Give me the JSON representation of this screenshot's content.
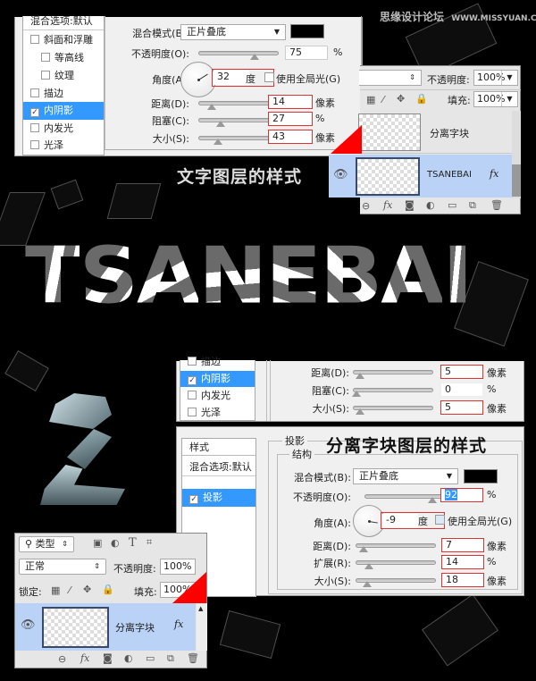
{
  "watermark": {
    "site_name": "思缘设计论坛",
    "site_url": "WWW.MISSYUAN.COM"
  },
  "captions": {
    "text_layer_style": "文字图层的样式",
    "split_block_layer_style": "分离字块图层的样式"
  },
  "artwork": {
    "title_text": "TSANEBAI",
    "colors": {
      "light": "#ffffff",
      "dark": "#6a6a6a"
    }
  },
  "top_dialog": {
    "style_list": [
      {
        "label": "混合选项:默认",
        "checked": null,
        "selected": false,
        "indent": false
      },
      {
        "label": "斜面和浮雕",
        "checked": false,
        "selected": false,
        "indent": false
      },
      {
        "label": "等高线",
        "checked": false,
        "selected": false,
        "indent": true
      },
      {
        "label": "纹理",
        "checked": false,
        "selected": false,
        "indent": true
      },
      {
        "label": "描边",
        "checked": false,
        "selected": false,
        "indent": false
      },
      {
        "label": "内阴影",
        "checked": true,
        "selected": true,
        "indent": false
      },
      {
        "label": "内发光",
        "checked": false,
        "selected": false,
        "indent": false
      },
      {
        "label": "光泽",
        "checked": false,
        "selected": false,
        "indent": false
      }
    ],
    "blend_mode_label": "混合模式(B):",
    "blend_mode_value": "正片叠底",
    "blend_color": "#000000",
    "opacity_label": "不透明度(O):",
    "opacity_value": "75",
    "opacity_unit": "%",
    "opacity_fraction": 0.75,
    "angle_label": "角度(A):",
    "angle_value": "32",
    "angle_unit": "度",
    "global_light_label": "使用全局光(G)",
    "global_light_checked": false,
    "distance_label": "距离(D):",
    "distance_value": "14",
    "distance_unit": "像素",
    "distance_fraction": 0.14,
    "choke_label": "阻塞(C):",
    "choke_value": "27",
    "choke_unit": "%",
    "choke_fraction": 0.27,
    "size_label": "大小(S):",
    "size_value": "43",
    "size_unit": "像素",
    "size_fraction": 0.23
  },
  "top_layers_panel": {
    "opacity_label": "不透明度:",
    "opacity_value": "100%",
    "fill_label": "填充:",
    "fill_value": "100%",
    "layers": [
      {
        "name": "分离字块",
        "selected": false,
        "visible": false,
        "fx": false
      },
      {
        "name": "TSANEBAI",
        "selected": true,
        "visible": true,
        "fx": true
      }
    ],
    "fx_label": "fx"
  },
  "mid_dialog": {
    "style_list": [
      {
        "label": "描边",
        "checked": false,
        "selected": false
      },
      {
        "label": "内阴影",
        "checked": true,
        "selected": true
      },
      {
        "label": "内发光",
        "checked": false,
        "selected": false
      },
      {
        "label": "光泽",
        "checked": false,
        "selected": false
      }
    ],
    "distance_label": "距离(D):",
    "distance_value": "5",
    "distance_unit": "像素",
    "distance_fraction": 0.05,
    "choke_label": "阻塞(C):",
    "choke_value": "0",
    "choke_unit": "%",
    "choke_fraction": 0.0,
    "size_label": "大小(S):",
    "size_value": "5",
    "size_unit": "像素",
    "size_fraction": 0.05
  },
  "bottom_dialog": {
    "styles_header": "样式",
    "style_list": [
      {
        "label": "混合选项:默认",
        "checked": null,
        "selected": false
      },
      {
        "label": "投影",
        "checked": true,
        "selected": true
      }
    ],
    "group_title": "投影",
    "subgroup_title": "结构",
    "blend_mode_label": "混合模式(B):",
    "blend_mode_value": "正片叠底",
    "blend_color": "#000000",
    "opacity_label": "不透明度(O):",
    "opacity_value": "92",
    "opacity_unit": "%",
    "opacity_fraction": 0.92,
    "angle_label": "角度(A):",
    "angle_value": "-9",
    "angle_unit": "度",
    "global_light_label": "使用全局光(G)",
    "global_light_checked": false,
    "distance_label": "距离(D):",
    "distance_value": "7",
    "distance_unit": "像素",
    "distance_fraction": 0.07,
    "spread_label": "扩展(R):",
    "spread_value": "14",
    "spread_unit": "%",
    "spread_fraction": 0.14,
    "size_label": "大小(S):",
    "size_value": "18",
    "size_unit": "像素",
    "size_fraction": 0.12
  },
  "bottom_layers_panel": {
    "filter_kind_label": "类型",
    "blend_mode_value": "正常",
    "opacity_label": "不透明度:",
    "opacity_value": "100%",
    "lock_label": "锁定:",
    "fill_label": "填充:",
    "fill_value": "100%",
    "layer_name": "分离字块",
    "fx_label": "fx"
  }
}
